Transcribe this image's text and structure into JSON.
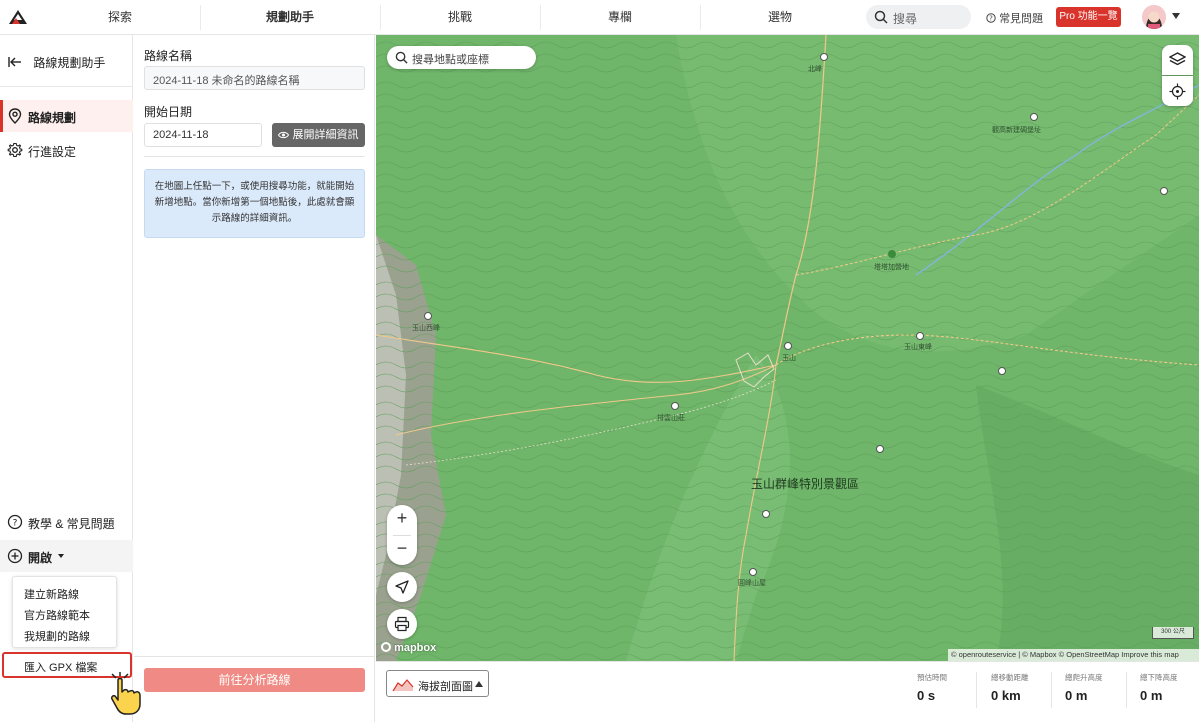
{
  "nav": {
    "items": [
      "探索",
      "規劃助手",
      "挑戰",
      "專欄",
      "選物"
    ],
    "active_index": 1,
    "search_placeholder": "搜尋",
    "faq": "常見問題",
    "pro": "Pro 功能一覽"
  },
  "sidebar": {
    "back_title": "路線規劃助手",
    "items": [
      {
        "label": "路線規劃",
        "icon": "location-pin-icon",
        "active": true
      },
      {
        "label": "行進設定",
        "icon": "gear-icon",
        "active": false
      }
    ],
    "help": "教學 & 常見問題",
    "open": "開啟",
    "dropdown": [
      "建立新路線",
      "官方路線範本",
      "我規劃的路線"
    ],
    "import_gpx": "匯入 GPX 檔案"
  },
  "panel": {
    "route_name_label": "路線名稱",
    "route_name_value": "2024-11-18 未命名的路線名稱",
    "start_date_label": "開始日期",
    "start_date_value": "2024-11-18",
    "expand_details": "展開詳細資訊",
    "info": "在地圖上任點一下，或使用搜尋功能，就能開始新增地點。當你新增第一個地點後，此處就會顯示路線的詳細資訊。",
    "analyze_button": "前往分析路線"
  },
  "map": {
    "search_placeholder": "搜尋地點或座標",
    "zoom_in": "+",
    "zoom_out": "−",
    "region_label": "玉山群峰特別景觀區",
    "places": [
      "北峰",
      "觀高新建碉堡址",
      "玉山西峰",
      "玉山",
      "玉山東峰",
      "排雲山莊",
      "圓峰山屋",
      "塔塔加營地"
    ],
    "attribution": "© openrouteservice | © Mapbox © OpenStreetMap  Improve this map",
    "scale": "300 公尺",
    "mapbox": "mapbox"
  },
  "bottom": {
    "elevation_button": "海拔剖面圖",
    "stats": [
      {
        "label": "預估時間",
        "value": "0 s"
      },
      {
        "label": "總移動距離",
        "value": "0 km"
      },
      {
        "label": "總爬升高度",
        "value": "0 m"
      },
      {
        "label": "總下降高度",
        "value": "0 m"
      }
    ]
  },
  "colors": {
    "accent": "#d9342b",
    "map_green": "#6fb56a",
    "info_blue": "#dbeafb"
  }
}
